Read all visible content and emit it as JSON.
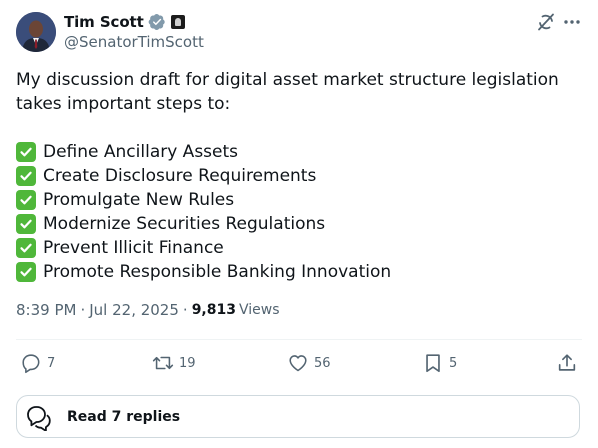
{
  "author": {
    "display_name": "Tim Scott",
    "handle": "@SenatorTimScott"
  },
  "tweet": {
    "intro": "My discussion draft for digital asset market structure legislation takes important steps to:",
    "items": [
      "Define Ancillary Assets",
      "Create Disclosure Requirements",
      "Promulgate New Rules",
      "Modernize Securities Regulations",
      "Prevent Illicit Finance",
      "Promote Responsible Banking Innovation"
    ]
  },
  "meta": {
    "time": "8:39 PM",
    "separator": "·",
    "date": "Jul 22, 2025",
    "views_count": "9,813",
    "views_label": "Views"
  },
  "actions": {
    "replies": "7",
    "reposts": "19",
    "likes": "56",
    "bookmarks": "5"
  },
  "read_replies_label": "Read 7 replies",
  "icons": {
    "verified": "verified-badge-icon",
    "affiliation": "government-affiliation-icon",
    "grok": "grok-icon",
    "more": "more-icon",
    "check": "check-mark-icon",
    "reply": "reply-icon",
    "repost": "repost-icon",
    "like": "heart-icon",
    "bookmark": "bookmark-icon",
    "share": "share-icon"
  },
  "colors": {
    "text": "#0f1419",
    "secondary": "#536471",
    "verified_gray": "#829aab",
    "check_green": "#4fb73a",
    "border": "#cfd9de"
  }
}
